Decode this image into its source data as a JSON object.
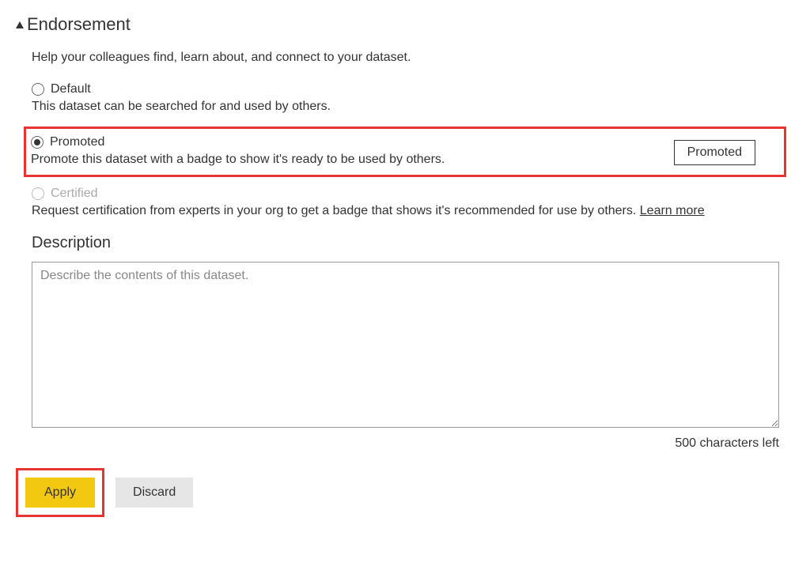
{
  "section": {
    "title": "Endorsement",
    "help_text": "Help your colleagues find, learn about, and connect to your dataset."
  },
  "options": {
    "default": {
      "label": "Default",
      "description": "This dataset can be searched for and used by others."
    },
    "promoted": {
      "label": "Promoted",
      "description": "Promote this dataset with a badge to show it's ready to be used by others.",
      "badge": "Promoted"
    },
    "certified": {
      "label": "Certified",
      "description": "Request certification from experts in your org to get a badge that shows it's recommended for use by others. ",
      "learn_more": "Learn more"
    }
  },
  "description": {
    "title": "Description",
    "placeholder": "Describe the contents of this dataset.",
    "char_count": "500 characters left"
  },
  "buttons": {
    "apply": "Apply",
    "discard": "Discard"
  }
}
